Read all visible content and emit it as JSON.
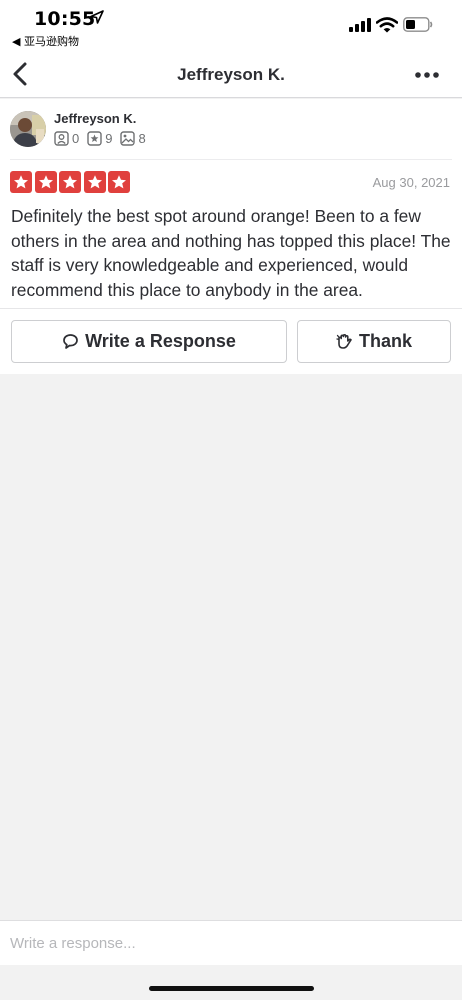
{
  "status_bar": {
    "time": "10:55",
    "back_app": "◀ 亚马逊购物"
  },
  "nav": {
    "title": "Jeffreyson K."
  },
  "review": {
    "user_name": "Jeffreyson K.",
    "stats": {
      "friends": "0",
      "reviews": "9",
      "photos": "8"
    },
    "rating": 5,
    "rating_max": 5,
    "date": "Aug 30, 2021",
    "text": "Definitely the best spot around orange! Been to a few others in the area and nothing has topped this place! The staff is very knowledgeable and experienced, would recommend this place to anybody in the area."
  },
  "actions": {
    "write_response": "Write a Response",
    "thank": "Thank"
  },
  "reply": {
    "placeholder": "Write a response..."
  },
  "colors": {
    "star_red": "#e0403d",
    "text_dark": "#2d2e33",
    "text_muted": "#9a9b9e"
  }
}
